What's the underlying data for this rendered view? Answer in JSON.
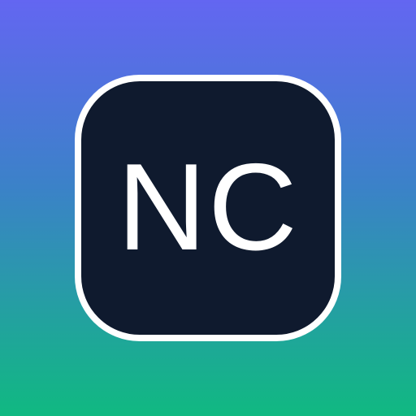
{
  "app_icon": {
    "monogram": "NC"
  },
  "colors": {
    "gradient_top": "#6366f1",
    "gradient_bottom": "#10b981",
    "tile_background": "#0f1a2e",
    "tile_border": "#ffffff",
    "text": "#ffffff"
  }
}
